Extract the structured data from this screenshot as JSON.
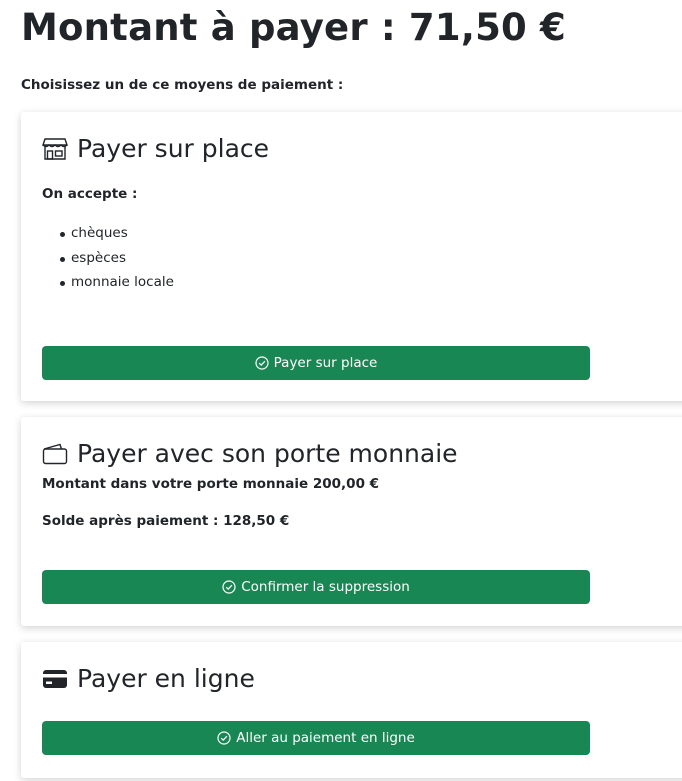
{
  "header": {
    "title": "Montant à payer : 71,50 €",
    "intro": "Choisissez un de ce moyens de paiement :"
  },
  "on_site": {
    "icon": "shop-icon",
    "title": "Payer sur place",
    "accept_label": "On accepte :",
    "methods": [
      "chèques",
      "espèces",
      "monnaie locale"
    ],
    "button_label": "Payer sur place"
  },
  "wallet": {
    "icon": "wallet-icon",
    "title": "Payer avec son porte monnaie",
    "balance_text": "Montant dans votre porte monnaie 200,00 €",
    "after_text": "Solde après paiement : 128,50 €",
    "button_label": "Confirmer la suppression"
  },
  "online": {
    "icon": "credit-card-icon",
    "title": "Payer en ligne",
    "button_label": "Aller au paiement en ligne"
  },
  "colors": {
    "button_bg": "#198754",
    "text": "#212529"
  }
}
